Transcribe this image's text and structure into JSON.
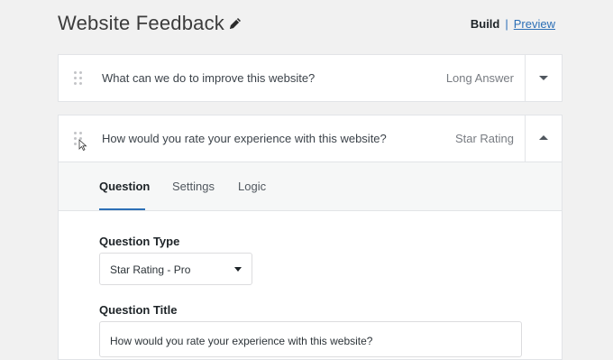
{
  "header": {
    "title": "Website Feedback",
    "edit_icon": "pencil-icon",
    "build_label": "Build",
    "separator": "|",
    "preview_label": "Preview"
  },
  "questions": [
    {
      "text": "What can we do to improve this website?",
      "type": "Long Answer",
      "expanded": false
    },
    {
      "text": "How would you rate your experience with this website?",
      "type": "Star Rating",
      "expanded": true
    }
  ],
  "editor": {
    "tabs": [
      "Question",
      "Settings",
      "Logic"
    ],
    "active_tab": "Question",
    "question_type_label": "Question Type",
    "question_type_value": "Star Rating - Pro",
    "question_title_label": "Question Title",
    "question_title_value": "How would you rate your experience with this website?"
  },
  "colors": {
    "accent": "#2c6fb6",
    "background": "#f1f1f1"
  }
}
